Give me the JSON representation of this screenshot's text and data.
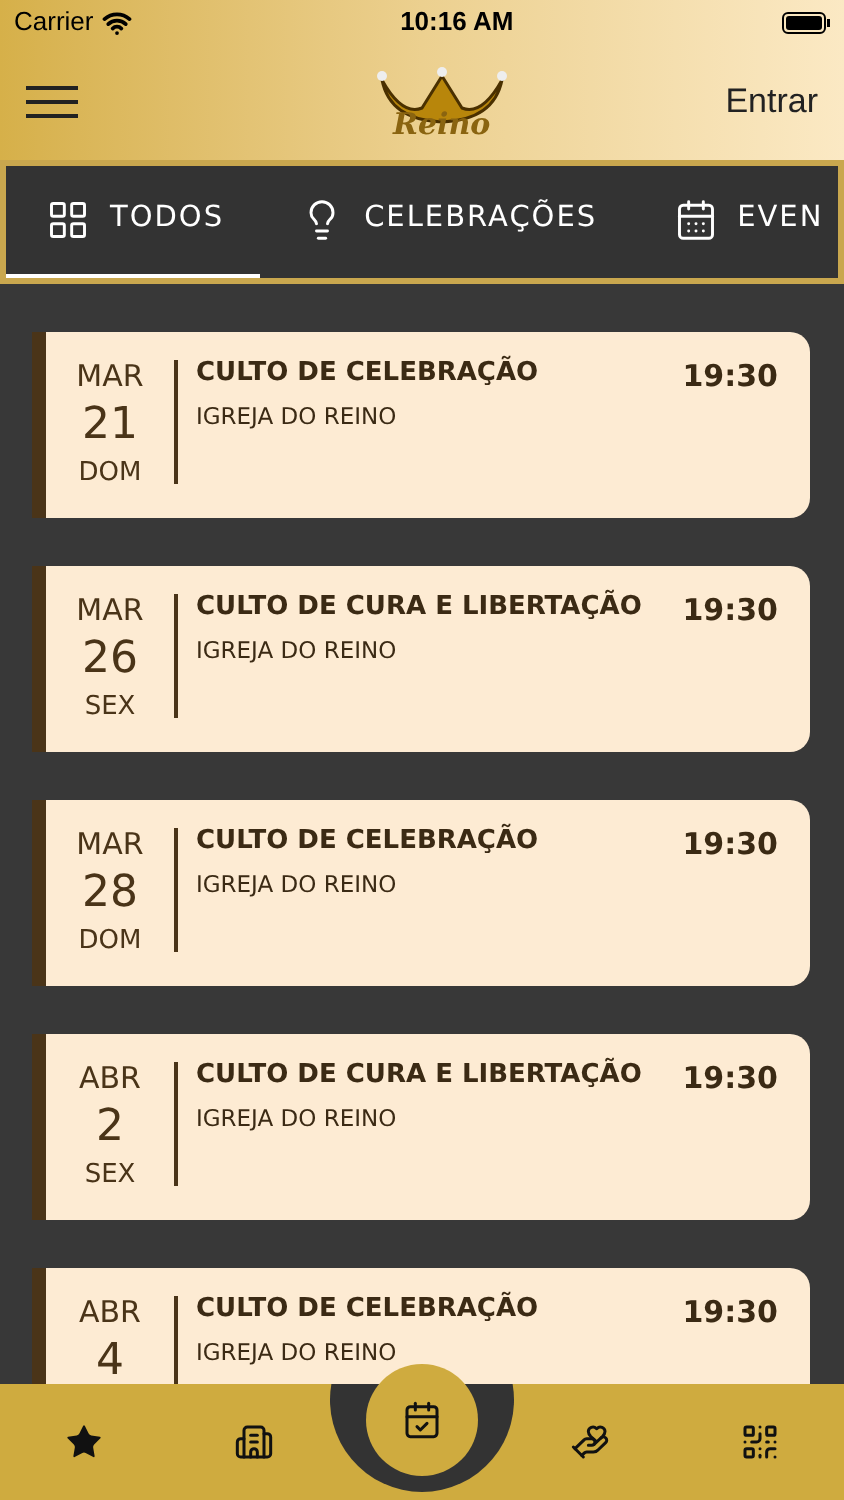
{
  "status_bar": {
    "carrier": "Carrier",
    "time": "10:16 AM"
  },
  "header": {
    "logo_text": "Reino",
    "login": "Entrar"
  },
  "tabs": [
    {
      "label": "TODOS",
      "selected": true
    },
    {
      "label": "CELEBRAÇÕES",
      "selected": false
    },
    {
      "label": "EVEN",
      "selected": false
    }
  ],
  "events": [
    {
      "month": "MAR",
      "day": "21",
      "weekday": "DOM",
      "title": "CULTO DE CELEBRAÇÃO",
      "place": "IGREJA DO REINO",
      "time": "19:30"
    },
    {
      "month": "MAR",
      "day": "26",
      "weekday": "SEX",
      "title": "CULTO DE CURA E LIBERTAÇÃO",
      "place": "IGREJA DO REINO",
      "time": "19:30"
    },
    {
      "month": "MAR",
      "day": "28",
      "weekday": "DOM",
      "title": "CULTO DE CELEBRAÇÃO",
      "place": "IGREJA DO REINO",
      "time": "19:30"
    },
    {
      "month": "ABR",
      "day": "2",
      "weekday": "SEX",
      "title": "CULTO DE CURA E LIBERTAÇÃO",
      "place": "IGREJA DO REINO",
      "time": "19:30"
    },
    {
      "month": "ABR",
      "day": "4",
      "title": "CULTO DE CELEBRAÇÃO",
      "place": "IGREJA DO REINO",
      "time": "19:30"
    }
  ],
  "bottom_nav": [
    {
      "selected": false
    },
    {
      "selected": false
    },
    {
      "selected": true
    },
    {
      "selected": false
    },
    {
      "selected": false
    }
  ]
}
